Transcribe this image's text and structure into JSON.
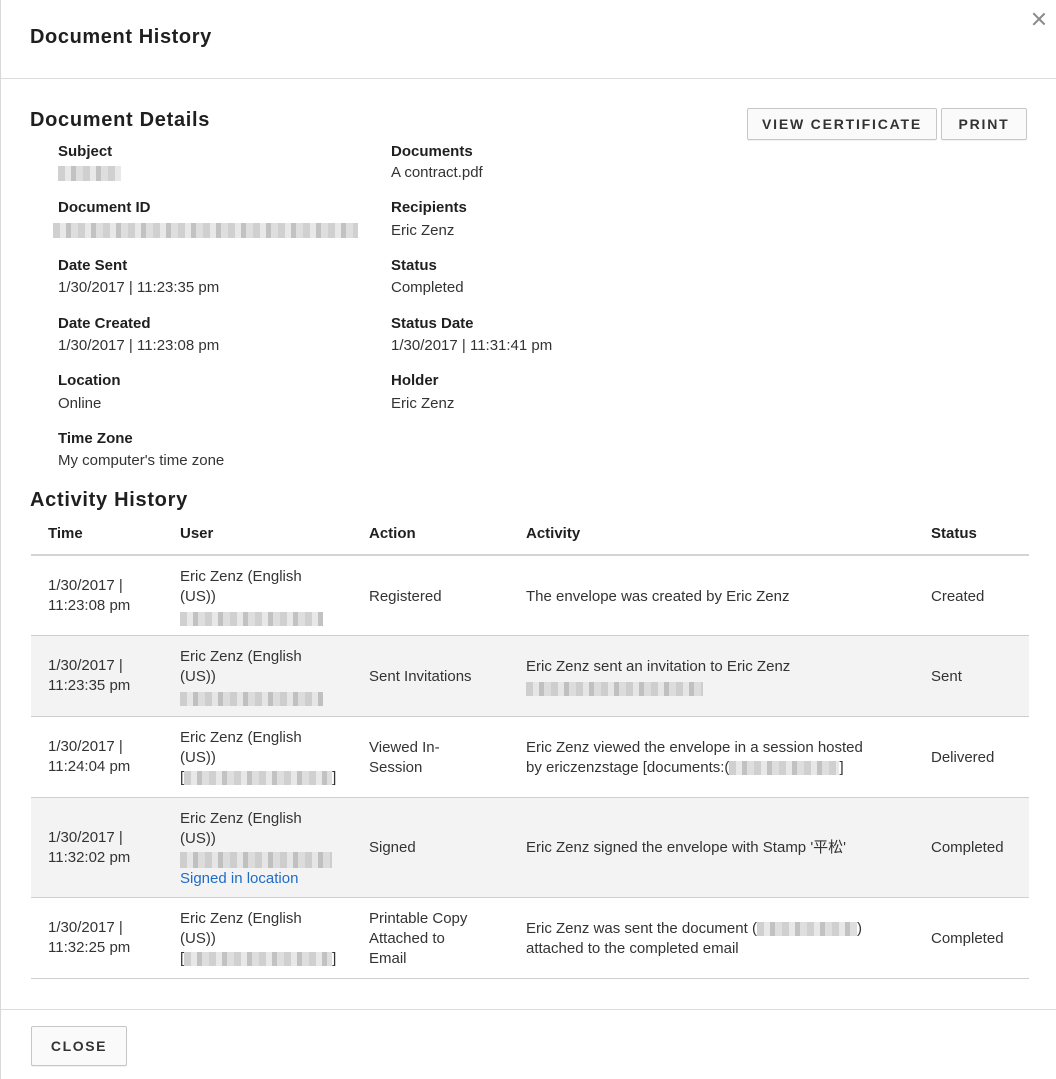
{
  "modal": {
    "title": "Document History",
    "close_icon": "close-x-icon"
  },
  "details": {
    "title": "Document Details",
    "buttons": {
      "view_certificate": "VIEW CERTIFICATE",
      "print": "PRINT"
    },
    "subject": {
      "label": "Subject"
    },
    "document_id": {
      "label": "Document ID"
    },
    "date_sent": {
      "label": "Date Sent",
      "value": "1/30/2017 | 11:23:35 pm"
    },
    "date_created": {
      "label": "Date Created",
      "value": "1/30/2017 | 11:23:08 pm"
    },
    "location": {
      "label": "Location",
      "value": "Online"
    },
    "time_zone": {
      "label": "Time Zone",
      "value": "My computer's time zone"
    },
    "documents": {
      "label": "Documents",
      "value": "A contract.pdf"
    },
    "recipients": {
      "label": "Recipients",
      "value": "Eric Zenz"
    },
    "status": {
      "label": "Status",
      "value": "Completed"
    },
    "status_date": {
      "label": "Status Date",
      "value": "1/30/2017 | 11:31:41 pm"
    },
    "holder": {
      "label": "Holder",
      "value": "Eric Zenz"
    }
  },
  "activity": {
    "title": "Activity History",
    "columns": {
      "time": "Time",
      "user": "User",
      "action": "Action",
      "activity": "Activity",
      "status": "Status"
    },
    "rows": [
      {
        "time_1": "1/30/2017 |",
        "time_2": "11:23:08 pm",
        "user_1": "Eric Zenz (English",
        "user_2": "(US))",
        "action_1": "Registered",
        "activity_1": "The envelope was created by Eric Zenz",
        "status": "Created"
      },
      {
        "time_1": "1/30/2017 |",
        "time_2": "11:23:35 pm",
        "user_1": "Eric Zenz (English",
        "user_2": "(US))",
        "action_1": "Sent Invitations",
        "activity_1": "Eric Zenz sent an invitation to Eric Zenz",
        "status": "Sent"
      },
      {
        "time_1": "1/30/2017 |",
        "time_2": "11:24:04 pm",
        "user_1": "Eric Zenz (English",
        "user_2": "(US))",
        "user_3_pre": "[",
        "user_3_post": "]",
        "action_1": "Viewed In-",
        "action_2": "Session",
        "activity_1": "Eric Zenz viewed the envelope in a session hosted",
        "activity_2_pre": "by ericzenzstage [documents:(",
        "activity_2_post": "]",
        "status": "Delivered"
      },
      {
        "time_1": "1/30/2017 |",
        "time_2": "11:32:02 pm",
        "user_1": "Eric Zenz (English",
        "user_2": "(US))",
        "user_link": "Signed in location",
        "action_1": "Signed",
        "activity_1": "Eric Zenz signed the envelope with Stamp '平松'",
        "status": "Completed"
      },
      {
        "time_1": "1/30/2017 |",
        "time_2": "11:32:25 pm",
        "user_1": "Eric Zenz (English",
        "user_2": "(US))",
        "user_3_pre": "[",
        "user_3_post": "]",
        "action_1": "Printable Copy",
        "action_2": "Attached to",
        "action_3": "Email",
        "activity_1_pre": "Eric Zenz was sent the document (",
        "activity_1_post": ")",
        "activity_2": "attached to the completed email",
        "status": "Completed"
      }
    ]
  },
  "footer": {
    "close_label": "CLOSE"
  }
}
